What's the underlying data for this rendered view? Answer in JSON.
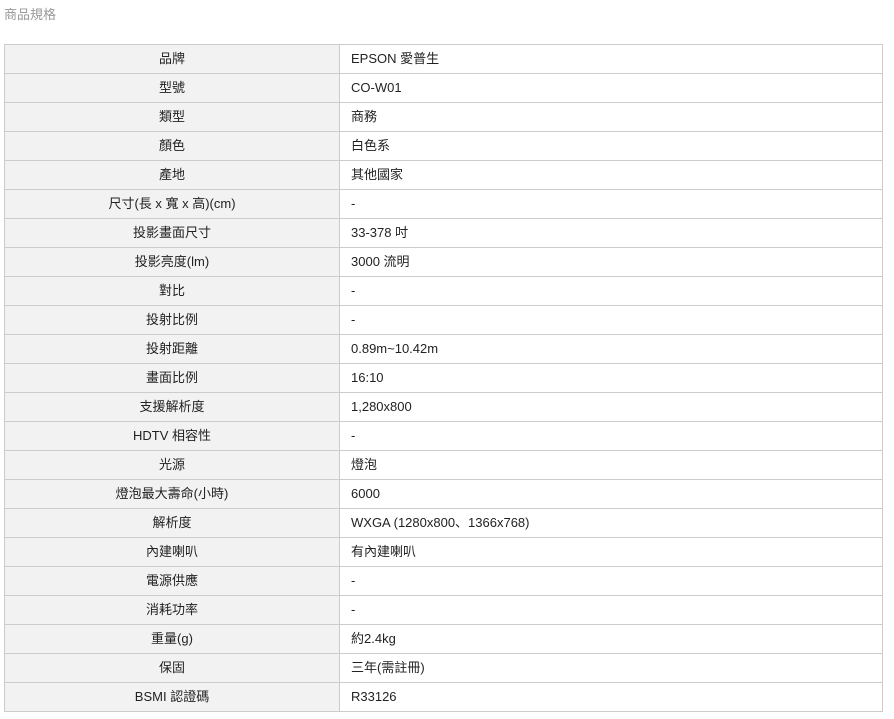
{
  "section_title": "商品規格",
  "specs": [
    {
      "label": "品牌",
      "value": "EPSON 愛普生"
    },
    {
      "label": "型號",
      "value": "CO-W01"
    },
    {
      "label": "類型",
      "value": "商務"
    },
    {
      "label": "顏色",
      "value": "白色系"
    },
    {
      "label": "產地",
      "value": "其他國家"
    },
    {
      "label": "尺寸(長 x 寬 x 高)(cm)",
      "value": "-"
    },
    {
      "label": "投影畫面尺寸",
      "value": "33-378 吋"
    },
    {
      "label": "投影亮度(lm)",
      "value": "3000 流明"
    },
    {
      "label": "對比",
      "value": "-"
    },
    {
      "label": "投射比例",
      "value": "-"
    },
    {
      "label": "投射距離",
      "value": "0.89m~10.42m"
    },
    {
      "label": "畫面比例",
      "value": "16:10"
    },
    {
      "label": "支援解析度",
      "value": "1,280x800"
    },
    {
      "label": "HDTV 相容性",
      "value": "-"
    },
    {
      "label": "光源",
      "value": "燈泡"
    },
    {
      "label": "燈泡最大壽命(小時)",
      "value": "6000"
    },
    {
      "label": "解析度",
      "value": "WXGA (1280x800、1366x768)"
    },
    {
      "label": "內建喇叭",
      "value": "有內建喇叭"
    },
    {
      "label": "電源供應",
      "value": "-"
    },
    {
      "label": "消耗功率",
      "value": "-"
    },
    {
      "label": "重量(g)",
      "value": "約2.4kg"
    },
    {
      "label": "保固",
      "value": "三年(需註冊)"
    },
    {
      "label": "BSMI 認證碼",
      "value": "R33126"
    }
  ]
}
